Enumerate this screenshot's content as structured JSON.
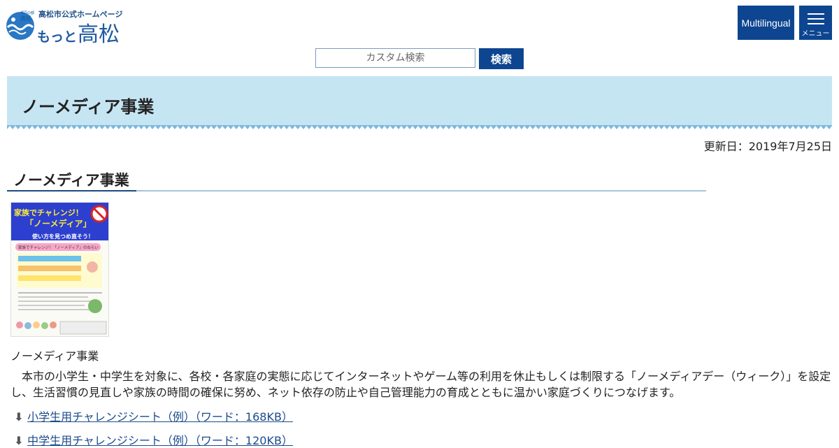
{
  "header": {
    "logo_mark_tiny": "瀬戸の都",
    "logo_mark_kanji": "高松",
    "logo_subtitle": "高松市公式ホームページ",
    "logo_main_kana": "もっと",
    "logo_main_kanji": "高松",
    "multilingual_label": "Multilingual",
    "menu_label": "メニュー"
  },
  "search": {
    "placeholder": "カスタム検索",
    "button_label": "検索"
  },
  "page": {
    "title": "ノーメディア事業",
    "updated": "更新日：2019年7月25日",
    "section_heading": "ノーメディア事業",
    "flyer": {
      "headline": "家族でチャレンジ！",
      "headline2": "「ノーメディア」",
      "band": "使い方を見つめ直そう！",
      "aims_title": "家族でチャレンジ！「ノーメディア」のねらい"
    },
    "caption": "ノーメディア事業",
    "body": "本市の小学生・中学生を対象に、各校・各家庭の実態に応じてインターネットやゲーム等の利用を休止もしくは制限する「ノーメディアデー（ウィーク）」を設定し、生活習慣の見直しや家族の時間の確保に努め、ネット依存の防止や自己管理能力の育成とともに温かい家庭づくりにつなげます。",
    "downloads": [
      {
        "label": "小学生用チャレンジシート（例）（ワード：168KB）"
      },
      {
        "label": "中学生用チャレンジシート（例）（ワード：120KB）"
      }
    ]
  },
  "colors": {
    "brand_navy": "#0d4590",
    "banner_bg": "#c6e5f3",
    "link": "#1a4b8c"
  }
}
